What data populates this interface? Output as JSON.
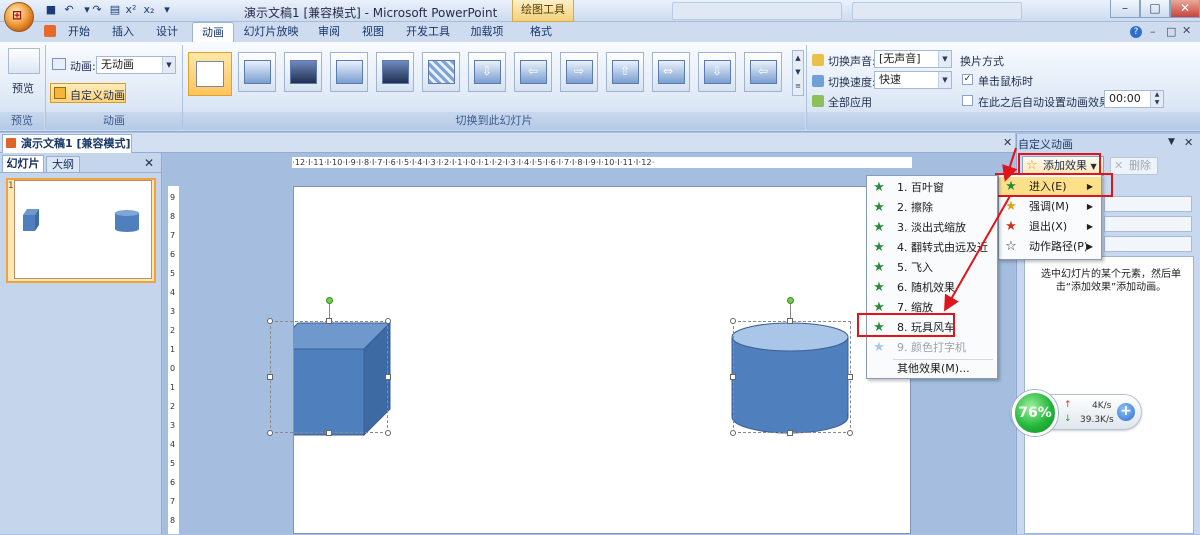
{
  "window": {
    "title": "演示文稿1 [兼容模式] - Microsoft PowerPoint",
    "context_tab": "绘图工具",
    "minimize": "–",
    "maximize": "□",
    "close": "✕"
  },
  "ribbon_tabs": [
    "开始",
    "插入",
    "设计",
    "动画",
    "幻灯片放映",
    "审阅",
    "视图",
    "开发工具",
    "加载项",
    "格式"
  ],
  "ribbon": {
    "preview": {
      "label": "预览",
      "group": "预览"
    },
    "animation": {
      "anim_label": "动画:",
      "anim_value": "无动画",
      "custom_label": "自定义动画",
      "group": "动画"
    },
    "transitions_group": "切换到此幻灯片",
    "sound_label": "切换声音:",
    "sound_value": "[无声音]",
    "speed_label": "切换速度:",
    "speed_value": "快速",
    "apply_all": "全部应用",
    "advance_title": "换片方式",
    "on_click": "单击鼠标时",
    "auto_after": "在此之后自动设置动画效果:",
    "auto_time": "00:00"
  },
  "document_tab": "演示文稿1 [兼容模式]",
  "left_panel": {
    "tab_slides": "幻灯片",
    "tab_outline": "大纲",
    "slide_number": "1",
    "close": "✕"
  },
  "ruler_text": "·12·I·11·I·10·I·9·I·8·I·7·I·6·I·5·I·4·I·3·I·2·I·1·I·0·I·1·I·2·I·3·I·4·I·5·I·6·I·7·I·8·I·9·I·10·I·11·I·12·",
  "vruler_digits": [
    "9",
    "8",
    "7",
    "6",
    "5",
    "4",
    "3",
    "2",
    "1",
    "0",
    "1",
    "2",
    "3",
    "4",
    "5",
    "6",
    "7",
    "8"
  ],
  "right_pane": {
    "title": "自定义动画",
    "add_effect": "添加效果",
    "remove": "删除",
    "hint": "选中幻灯片的某个元素，然后单击“添加效果”添加动画。"
  },
  "add_menu": [
    {
      "label": "进入(E)",
      "icon": "star-green-icon",
      "highlighted": true
    },
    {
      "label": "强调(M)",
      "icon": "star-yellow-icon"
    },
    {
      "label": "退出(X)",
      "icon": "star-red-icon"
    },
    {
      "label": "动作路径(P)",
      "icon": "star-outline-icon"
    }
  ],
  "entry_menu": [
    {
      "label": "1. 百叶窗",
      "icon": "blinds-star-icon"
    },
    {
      "label": "2. 擦除",
      "icon": "wipe-star-icon"
    },
    {
      "label": "3. 淡出式缩放",
      "icon": "fade-zoom-star-icon"
    },
    {
      "label": "4. 翻转式由远及近",
      "icon": "flip-star-icon"
    },
    {
      "label": "5. 飞入",
      "icon": "fly-in-star-icon"
    },
    {
      "label": "6. 随机效果",
      "icon": "random-star-icon"
    },
    {
      "label": "7. 缩放",
      "icon": "zoom-star-icon"
    },
    {
      "label": "8. 玩具风车",
      "icon": "pinwheel-star-icon",
      "highlighted": true
    },
    {
      "label": "9. 颜色打字机",
      "icon": "typewriter-star-icon",
      "disabled": true
    },
    {
      "label": "其他效果(M)...",
      "icon": ""
    }
  ],
  "network_widget": {
    "percent": "76%",
    "upload": "4K/s",
    "download": "39.3K/s",
    "plus": "+"
  },
  "colors": {
    "shape_fill": "#4f7fbd",
    "shape_dark": "#3e6aa3",
    "accent_red": "#e0141a",
    "highlight": "#ffe08a"
  }
}
